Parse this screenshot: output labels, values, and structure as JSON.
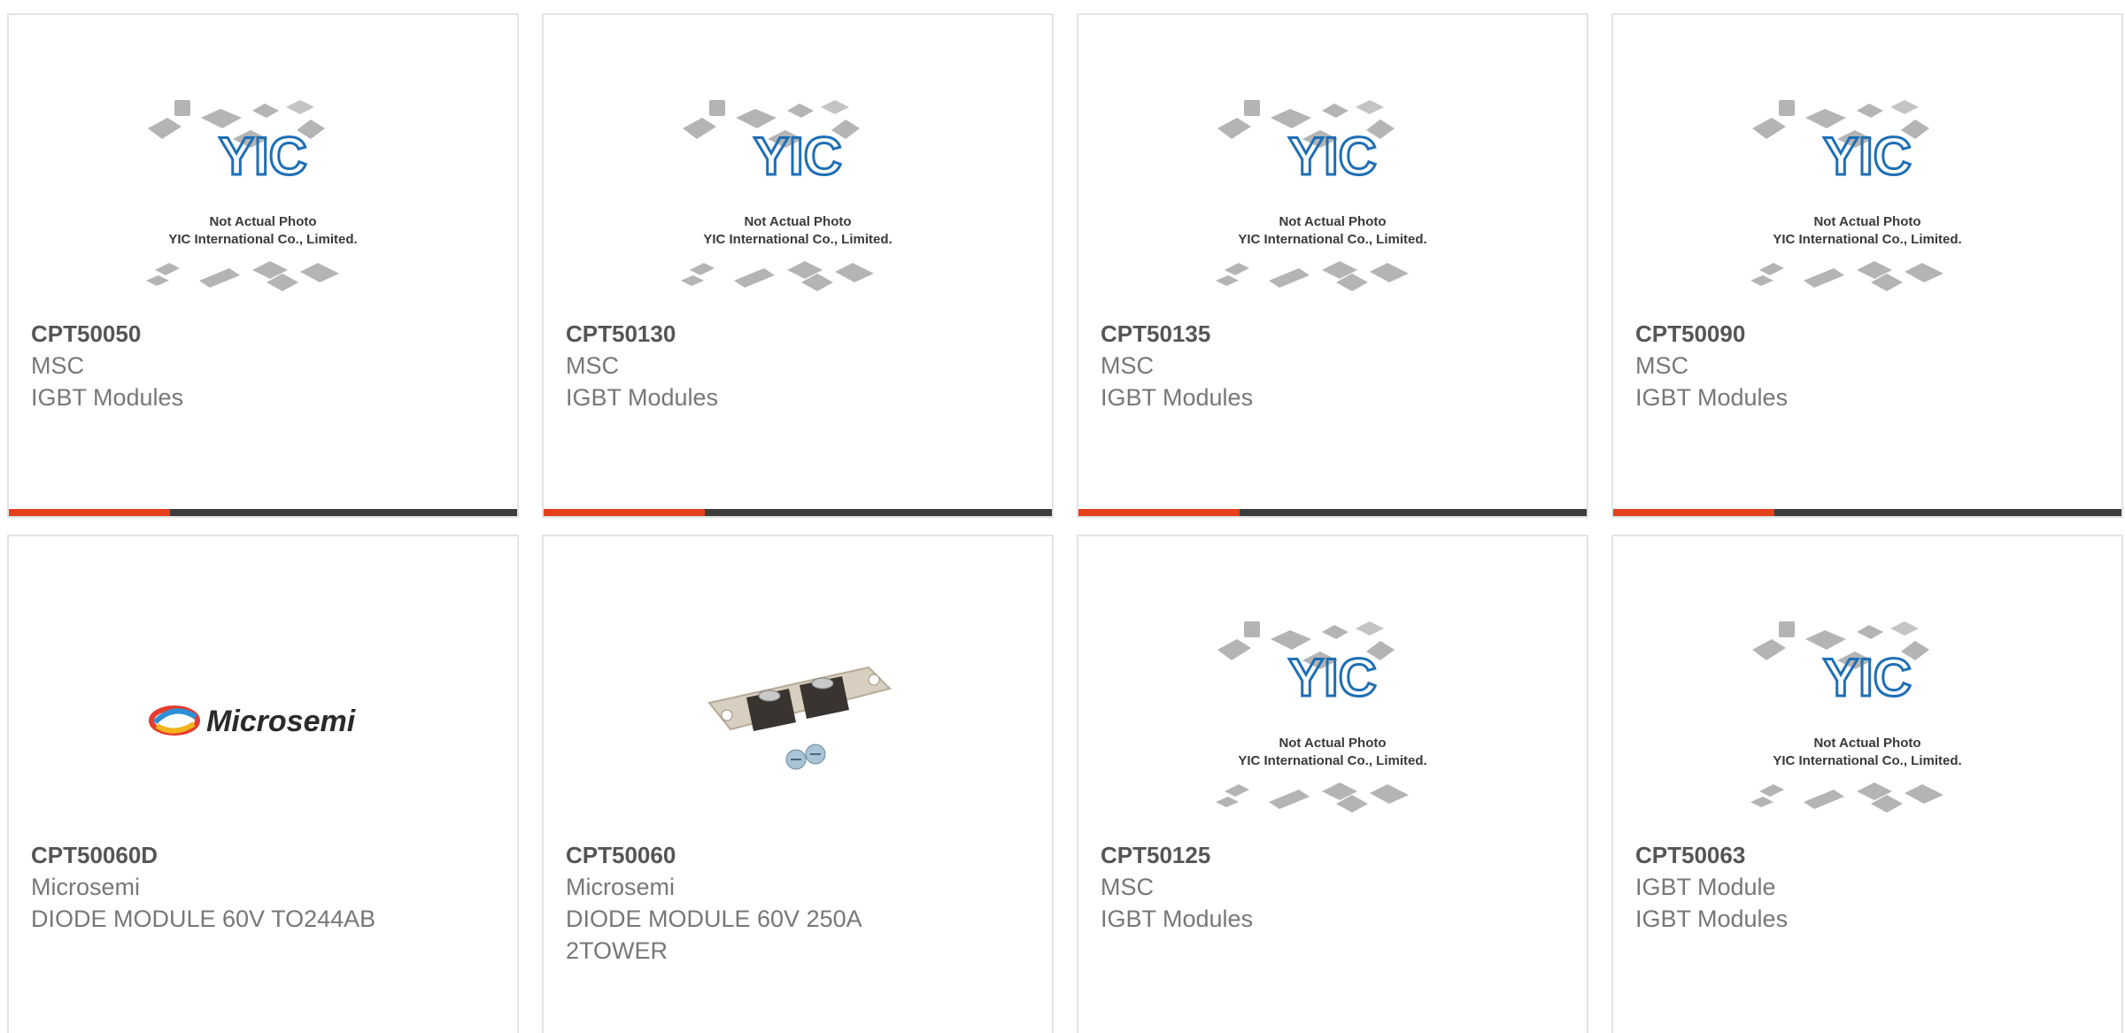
{
  "colors": {
    "accent": "#e5401c",
    "bar": "#3d3d3d",
    "border": "#e3e3e3",
    "part_text": "#555555",
    "meta_text": "#777777",
    "yic_logo": "#1e6fb5"
  },
  "placeholder": {
    "logo_text": "YIC",
    "line1": "Not Actual Photo",
    "line2": "YIC International Co., Limited."
  },
  "products": [
    {
      "part": "CPT50050",
      "manufacturer": "MSC",
      "description": "IGBT Modules",
      "image": "placeholder-image"
    },
    {
      "part": "CPT50130",
      "manufacturer": "MSC",
      "description": "IGBT Modules",
      "image": "placeholder-image"
    },
    {
      "part": "CPT50135",
      "manufacturer": "MSC",
      "description": "IGBT Modules",
      "image": "placeholder-image"
    },
    {
      "part": "CPT50090",
      "manufacturer": "MSC",
      "description": "IGBT Modules",
      "image": "placeholder-image"
    },
    {
      "part": "CPT50060D",
      "manufacturer": "Microsemi",
      "description": "DIODE MODULE 60V TO244AB",
      "image": "microsemi-logo",
      "brand_text": "Microsemi"
    },
    {
      "part": "CPT50060",
      "manufacturer": "Microsemi",
      "description": "DIODE MODULE 60V 250A 2TOWER",
      "image": "diode-module-photo"
    },
    {
      "part": "CPT50125",
      "manufacturer": "MSC",
      "description": "IGBT Modules",
      "image": "placeholder-image"
    },
    {
      "part": "CPT50063",
      "manufacturer": "IGBT Module",
      "description": "IGBT Modules",
      "image": "placeholder-image"
    }
  ]
}
